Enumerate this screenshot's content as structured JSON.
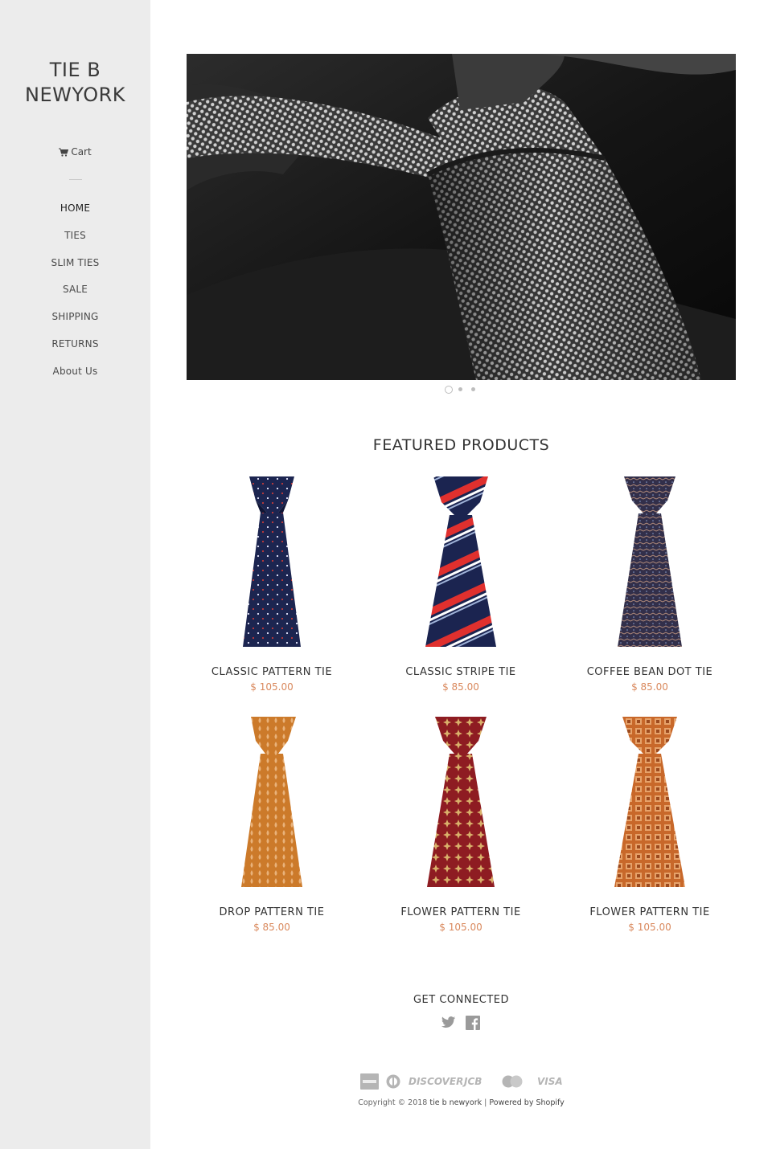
{
  "sidebar": {
    "logo_line1": "TIE B",
    "logo_line2": "NEWYORK",
    "cart_label": "Cart",
    "cart_icon": "cart-icon",
    "nav": [
      {
        "label": "HOME",
        "active": true
      },
      {
        "label": "TIES"
      },
      {
        "label": "SLIM TIES"
      },
      {
        "label": "SALE"
      },
      {
        "label": "SHIPPING"
      },
      {
        "label": "RETURNS"
      },
      {
        "label": "About Us"
      }
    ]
  },
  "slideshow": {
    "slide_count": 3,
    "active_index": 0
  },
  "featured": {
    "title": "FEATURED PRODUCTS",
    "products": [
      {
        "name": "CLASSIC PATTERN TIE",
        "price": "$ 105.00",
        "color": "#1c2550"
      },
      {
        "name": "CLASSIC STRIPE TIE",
        "price": "$ 85.00",
        "color": "#1b2450"
      },
      {
        "name": "COFFEE BEAN DOT TIE",
        "price": "$ 85.00",
        "color": "#322f4a"
      },
      {
        "name": "DROP PATTERN TIE",
        "price": "$ 85.00",
        "color": "#cc7a2a"
      },
      {
        "name": "FLOWER PATTERN TIE",
        "price": "$ 105.00",
        "color": "#8e1c22"
      },
      {
        "name": "FLOWER PATTERN TIE",
        "price": "$ 105.00",
        "color": "#c8682a"
      }
    ]
  },
  "footer": {
    "connect_title": "GET CONNECTED",
    "social_icons": [
      "twitter-icon",
      "facebook-icon"
    ],
    "payment_icons": [
      "american-express-icon",
      "diners-club-icon",
      "discover-icon",
      "jcb-icon",
      "master-card-icon",
      "visa-icon"
    ],
    "payment_labels": {
      "discover": "DISCOVER",
      "jcb": "JCB",
      "visa": "VISA"
    },
    "copyright_prefix": "Copyright © 2018",
    "shop_name": "tie b newyork",
    "separator": "|",
    "powered_by": "Powered by Shopify"
  },
  "colors": {
    "sidebar_bg": "#ececec",
    "price": "#d9885c",
    "text": "#333333"
  }
}
